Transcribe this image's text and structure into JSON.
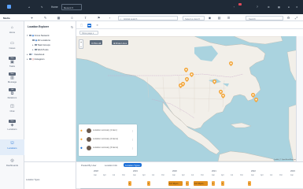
{
  "topbar": {
    "brand": "Home",
    "dropdown": "Recent"
  },
  "toolbar": {
    "title": "Media",
    "search_placeholder": "Global search",
    "select_placeholder": "Select a view",
    "right_search_placeholder": "Search"
  },
  "leftnav": {
    "items": [
      {
        "label": "Home",
        "icon": "home-icon"
      },
      {
        "label": "Cases",
        "icon": "folder-icon"
      },
      {
        "label": "Tasks",
        "icon": "tasks-icon",
        "pill": "New"
      },
      {
        "label": "Message",
        "icon": "message-icon",
        "pill": "New"
      },
      {
        "label": "Relations",
        "icon": "relation-icon",
        "pill": "Lab"
      },
      {
        "label": "Chat",
        "icon": "chat-icon"
      },
      {
        "label": "Locations",
        "icon": "location-icon",
        "pill": "New"
      },
      {
        "label": "Locations",
        "icon": "map-icon",
        "active": true
      },
      {
        "label": "Dashboards",
        "icon": "dashboard-icon"
      }
    ]
  },
  "explorer": {
    "title": "Location Explorer",
    "tree": [
      {
        "label": "Cross Network",
        "level": 0,
        "expanded": true
      },
      {
        "label": "All Locations",
        "level": 1
      },
      {
        "label": "Task Groups",
        "level": 1
      },
      {
        "label": "Web Posts",
        "level": 1
      },
      {
        "label": "Facebook",
        "level": 0
      },
      {
        "label": "Instagram",
        "level": 0
      }
    ]
  },
  "map_toolbar": {
    "page_select": "Show page"
  },
  "map": {
    "btn_pins": "Pins All",
    "btn_draw": "Draw Lines",
    "attribution": "Leaflet | © OpenStreetMap contributors",
    "zoom_in": "+",
    "zoom_out": "−",
    "legend": [
      {
        "text": "Location summary (1 item)",
        "color": "#f3a63b"
      },
      {
        "text": "Location summary (2 items)",
        "color": "#f3a63b"
      },
      {
        "text": "Location summary (3 items)",
        "color": "#1c6fd6"
      }
    ]
  },
  "timeline": {
    "tabs": [
      "Posted By User",
      "Location Info",
      "Location Types"
    ],
    "row_label": "Location Types",
    "years": [
      "2018",
      "2019",
      "2020",
      "2021",
      "2022",
      "2023"
    ],
    "months": [
      "Jan",
      "Apr",
      "Jul",
      "Oct",
      "Jan",
      "Apr",
      "Jul",
      "Oct",
      "Jan",
      "Apr",
      "Jul",
      "Oct",
      "Jan",
      "Apr",
      "Jul",
      "Oct",
      "Jan",
      "Apr",
      "Jul",
      "Oct",
      "Jan"
    ],
    "events": [
      "1",
      "1",
      "Fort Myers…",
      "1",
      "Fort Myers…",
      "1",
      "1",
      "1"
    ]
  },
  "colors": {
    "accent": "#1c6fd6",
    "pin": "#f3a63b",
    "topbar": "#1f2a37"
  }
}
